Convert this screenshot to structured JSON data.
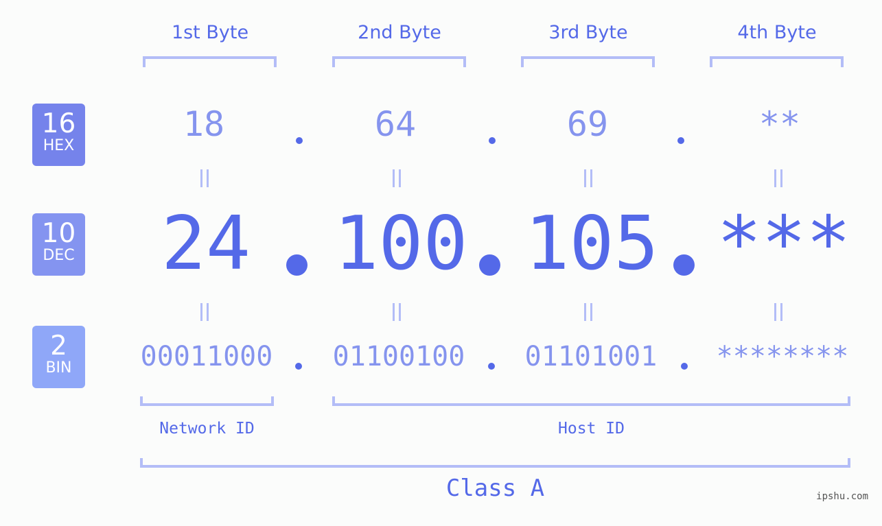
{
  "headers": [
    "1st Byte",
    "2nd Byte",
    "3rd Byte",
    "4th Byte"
  ],
  "badges": [
    {
      "num": "16",
      "label": "HEX",
      "color": "#7583eb"
    },
    {
      "num": "10",
      "label": "DEC",
      "color": "#8494f0"
    },
    {
      "num": "2",
      "label": "BIN",
      "color": "#8fa7f8"
    }
  ],
  "hex": [
    "18",
    "64",
    "69",
    "**"
  ],
  "dec": [
    "24",
    "100",
    "105",
    "***"
  ],
  "bin": [
    "00011000",
    "01100100",
    "01101001",
    "********"
  ],
  "network_id_label": "Network ID",
  "host_id_label": "Host ID",
  "class_label": "Class A",
  "watermark": "ipshu.com",
  "colors": {
    "primary": "#5469e8",
    "light": "#8594ee",
    "bracket": "#b3bdf7",
    "background": "#fbfcfb"
  }
}
